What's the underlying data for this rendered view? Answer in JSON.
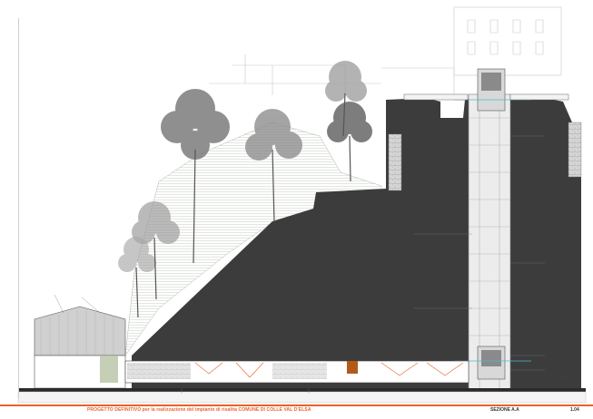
{
  "title_bar": {
    "project_title": "PROGETTO DEFINITIVO per la realizzazione del impianto di risalita COMUNE DI COLLE VAL D'ELSA",
    "section_label": "SEZIONE A.A",
    "sheet_number": "1.04"
  },
  "colors": {
    "accent": "#e8622a",
    "rock_fill": "#3c3c3c",
    "slope_fill": "#c9d2c2",
    "shaft_fill": "#ececec"
  }
}
